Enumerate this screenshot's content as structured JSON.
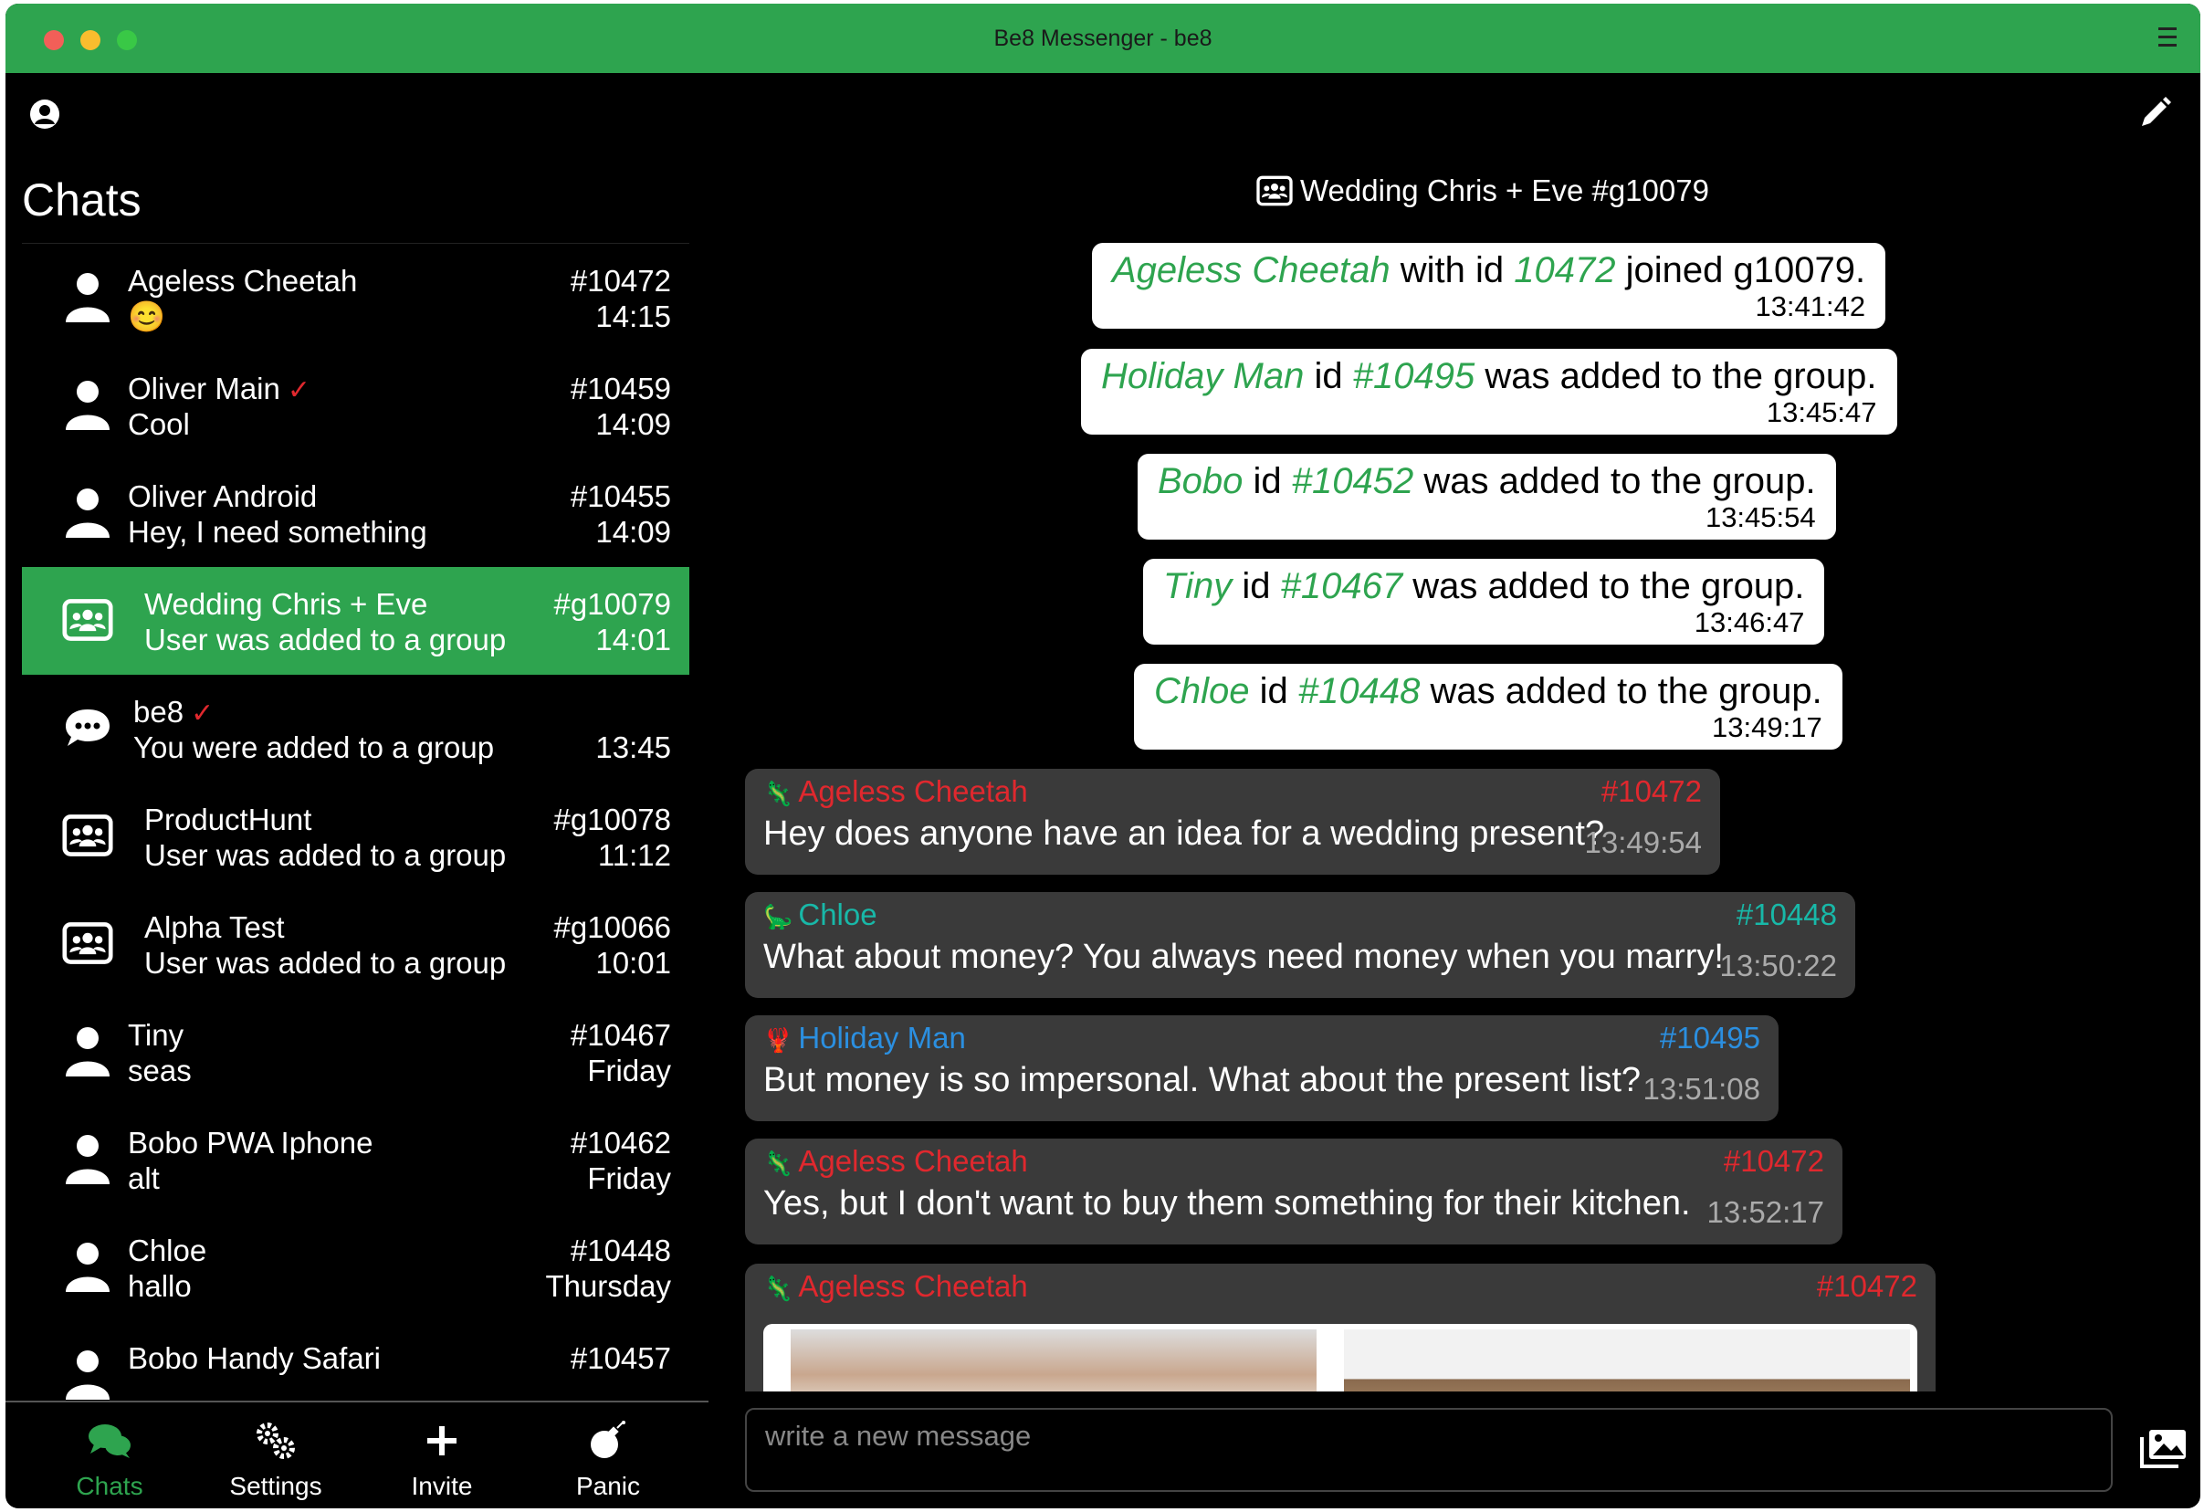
{
  "window": {
    "title": "Be8 Messenger - be8"
  },
  "sidebar": {
    "heading": "Chats",
    "chats": [
      {
        "name": "Ageless Cheetah",
        "snippet": "😊",
        "id": "#10472",
        "time": "14:15",
        "type": "user",
        "verified": false
      },
      {
        "name": "Oliver Main",
        "snippet": "Cool",
        "id": "#10459",
        "time": "14:09",
        "type": "user",
        "verified": true
      },
      {
        "name": "Oliver Android",
        "snippet": "Hey, I need something",
        "id": "#10455",
        "time": "14:09",
        "type": "user",
        "verified": false
      },
      {
        "name": "Wedding Chris + Eve",
        "snippet": "User was added to a group",
        "id": "#g10079",
        "time": "14:01",
        "type": "group",
        "active": true
      },
      {
        "name": "be8",
        "snippet": "You were added to a group",
        "id": "",
        "time": "13:45",
        "type": "self",
        "verified": true
      },
      {
        "name": "ProductHunt",
        "snippet": "User was added to a group",
        "id": "#g10078",
        "time": "11:12",
        "type": "group"
      },
      {
        "name": "Alpha Test",
        "snippet": "User was added to a group",
        "id": "#g10066",
        "time": "10:01",
        "type": "group"
      },
      {
        "name": "Tiny",
        "snippet": "seas",
        "id": "#10467",
        "time": "Friday",
        "type": "user"
      },
      {
        "name": "Bobo PWA Iphone",
        "snippet": "alt",
        "id": "#10462",
        "time": "Friday",
        "type": "user"
      },
      {
        "name": "Chloe",
        "snippet": "hallo",
        "id": "#10448",
        "time": "Thursday",
        "type": "user"
      },
      {
        "name": "Bobo Handy Safari",
        "snippet": "",
        "id": "#10457",
        "time": "",
        "type": "user"
      }
    ]
  },
  "nav": {
    "chats": "Chats",
    "settings": "Settings",
    "invite": "Invite",
    "panic": "Panic"
  },
  "conversation": {
    "title": "Wedding Chris + Eve #g10079",
    "system_messages": [
      {
        "name": "Ageless Cheetah",
        "mid": "with id",
        "uid": "10472",
        "rest": "joined g10079.",
        "time": "13:41:42"
      },
      {
        "name": "Holiday Man",
        "mid": "id",
        "uid": "#10495",
        "rest": "was added to the group.",
        "time": "13:45:47"
      },
      {
        "name": "Bobo",
        "mid": "id",
        "uid": "#10452",
        "rest": "was added to the group.",
        "time": "13:45:54"
      },
      {
        "name": "Tiny",
        "mid": "id",
        "uid": "#10467",
        "rest": "was added to the group.",
        "time": "13:46:47"
      },
      {
        "name": "Chloe",
        "mid": "id",
        "uid": "#10448",
        "rest": "was added to the group.",
        "time": "13:49:17"
      }
    ],
    "messages": [
      {
        "sender": "Ageless Cheetah",
        "id": "#10472",
        "text": "Hey does anyone have an idea for a wedding present?",
        "time": "13:49:54",
        "color": "#e0282e",
        "emoji": "🦎"
      },
      {
        "sender": "Chloe",
        "id": "#10448",
        "text": "What about money? You always need money when you marry!",
        "time": "13:50:22",
        "color": "#18b8a8",
        "emoji": "🦕"
      },
      {
        "sender": "Holiday Man",
        "id": "#10495",
        "text": "But money is so impersonal. What about the present list?",
        "time": "13:51:08",
        "color": "#2b8fe0",
        "emoji": "🦞"
      },
      {
        "sender": "Ageless Cheetah",
        "id": "#10472",
        "text": "Yes, but I don't want to buy them something for their kitchen.",
        "time": "13:52:17",
        "color": "#e0282e",
        "emoji": "🦎"
      },
      {
        "sender": "Ageless Cheetah",
        "id": "#10472",
        "text": "",
        "time": "",
        "color": "#e0282e",
        "emoji": "🦎"
      }
    ],
    "input_placeholder": "write a new message"
  },
  "colors": {
    "accent": "#2ea44f",
    "background": "#000000",
    "bubble": "#3a3a3a"
  }
}
